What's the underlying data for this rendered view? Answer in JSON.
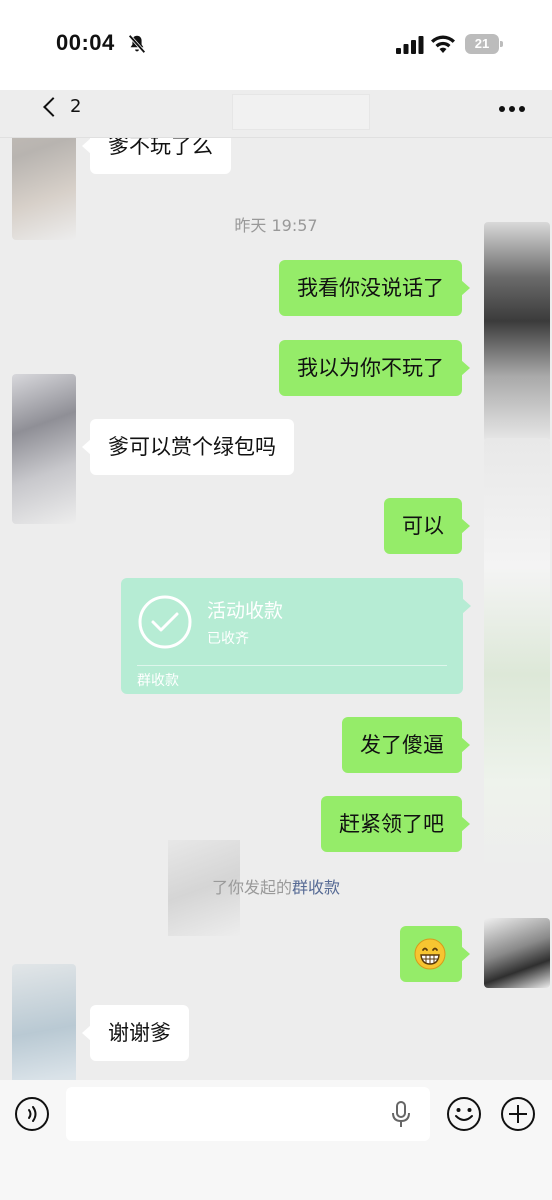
{
  "status_bar": {
    "time": "00:04",
    "battery": "21",
    "icons": [
      "bell-slash-icon",
      "cellular-signal-icon",
      "wifi-icon",
      "battery-icon"
    ]
  },
  "nav": {
    "back_count": "2",
    "more_icon": "ellipsis-icon"
  },
  "messages": [
    {
      "side": "left",
      "type": "text",
      "text": "爹不玩了么"
    },
    {
      "side": "center",
      "type": "timestamp",
      "text": "昨天 19:57"
    },
    {
      "side": "right",
      "type": "text",
      "text": "我看你没说话了"
    },
    {
      "side": "right",
      "type": "text",
      "text": "我以为你不玩了"
    },
    {
      "side": "left",
      "type": "text",
      "text": "爹可以赏个绿包吗"
    },
    {
      "side": "right",
      "type": "text",
      "text": "可以"
    },
    {
      "side": "right",
      "type": "group_payment",
      "title": "活动收款",
      "status": "已收齐",
      "footer": "群收款"
    },
    {
      "side": "right",
      "type": "text",
      "text": "发了傻逼"
    },
    {
      "side": "right",
      "type": "text",
      "text": "赶紧领了吧"
    },
    {
      "side": "center",
      "type": "system",
      "text_prefix": "了你发起的",
      "link": "群收款"
    },
    {
      "side": "right",
      "type": "emoji",
      "emoji": "grinning-face-emoji"
    },
    {
      "side": "left",
      "type": "text",
      "text": "谢谢爹"
    }
  ],
  "input_bar": {
    "placeholder": "",
    "icons": [
      "voice-icon",
      "microphone-icon",
      "emoji-icon",
      "plus-icon"
    ]
  },
  "colors": {
    "background": "#ededed",
    "bubble_self": "#95ec69",
    "bubble_other": "#ffffff",
    "payment_card": "#b6ecd4",
    "link": "#576b95"
  }
}
